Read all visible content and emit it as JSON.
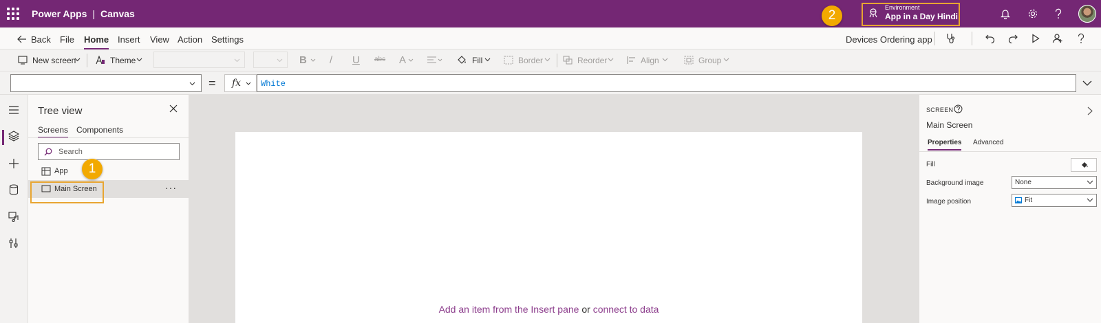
{
  "header": {
    "product": "Power Apps",
    "separator": "|",
    "app_type": "Canvas",
    "environment_label": "Environment",
    "environment_name": "App in a Day Hindi",
    "callout_2": "2"
  },
  "menu": {
    "back": "Back",
    "items": [
      "File",
      "Home",
      "Insert",
      "View",
      "Action",
      "Settings"
    ],
    "active": "Home",
    "app_name": "Devices Ordering app"
  },
  "ribbon": {
    "new_screen": "New screen",
    "theme": "Theme",
    "bold": "B",
    "italic": "/",
    "underline": "U",
    "strike": "abc",
    "font_color": "A",
    "fill": "Fill",
    "border": "Border",
    "reorder": "Reorder",
    "align": "Align",
    "group": "Group"
  },
  "formula": {
    "equals": "=",
    "fx": "fx",
    "value": "White"
  },
  "tree": {
    "title": "Tree view",
    "tabs": [
      "Screens",
      "Components"
    ],
    "search_placeholder": "Search",
    "app_item": "App",
    "screen_item": "Main Screen",
    "more": "···",
    "callout_1": "1"
  },
  "canvas": {
    "hint_link_1": "Add an item from the Insert pane",
    "hint_or": " or ",
    "hint_link_2": "connect to data"
  },
  "properties": {
    "type": "SCREEN",
    "name": "Main Screen",
    "tabs": [
      "Properties",
      "Advanced"
    ],
    "fill_label": "Fill",
    "bg_image_label": "Background image",
    "bg_image_value": "None",
    "img_pos_label": "Image position",
    "img_pos_value": "Fit"
  },
  "colors": {
    "brand": "#742774",
    "callout": "#f2a900",
    "highlight": "#e8a531"
  }
}
